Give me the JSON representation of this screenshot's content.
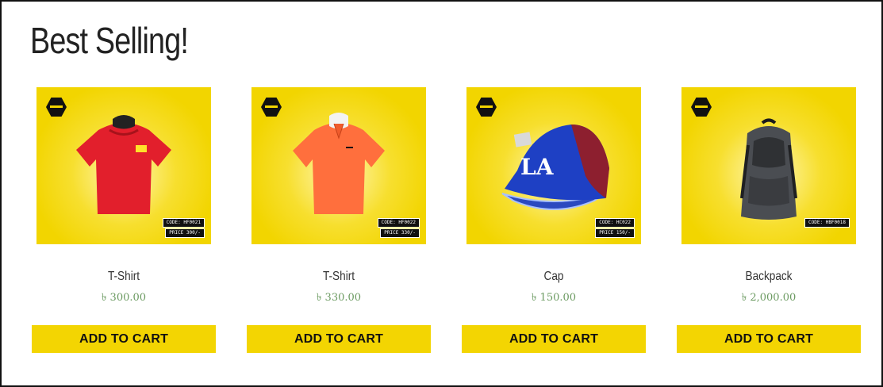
{
  "section": {
    "title": "Best Selling!"
  },
  "products": [
    {
      "name": "T-Shirt",
      "price": "৳ 300.00",
      "code": "CODE: HF0021",
      "price_tag": "PRICE 300/-",
      "button": "ADD TO CART",
      "color": "#e21f2c"
    },
    {
      "name": "T-Shirt",
      "price": "৳ 330.00",
      "code": "CODE: HF0022",
      "price_tag": "PRICE 330/-",
      "button": "ADD TO CART",
      "color": "#ff6f3d"
    },
    {
      "name": "Cap",
      "price": "৳ 150.00",
      "code": "CODE: HC022",
      "price_tag": "PRICE 150/-",
      "button": "ADD TO CART",
      "color": "#1e40c4"
    },
    {
      "name": "Backpack",
      "price": "৳ 2,000.00",
      "code": "CODE: HBF0018",
      "price_tag": "",
      "button": "ADD TO CART",
      "color": "#4a4d52"
    }
  ],
  "icons": [
    "brand-logo-icon",
    "tshirt-icon",
    "cap-icon",
    "backpack-icon"
  ]
}
